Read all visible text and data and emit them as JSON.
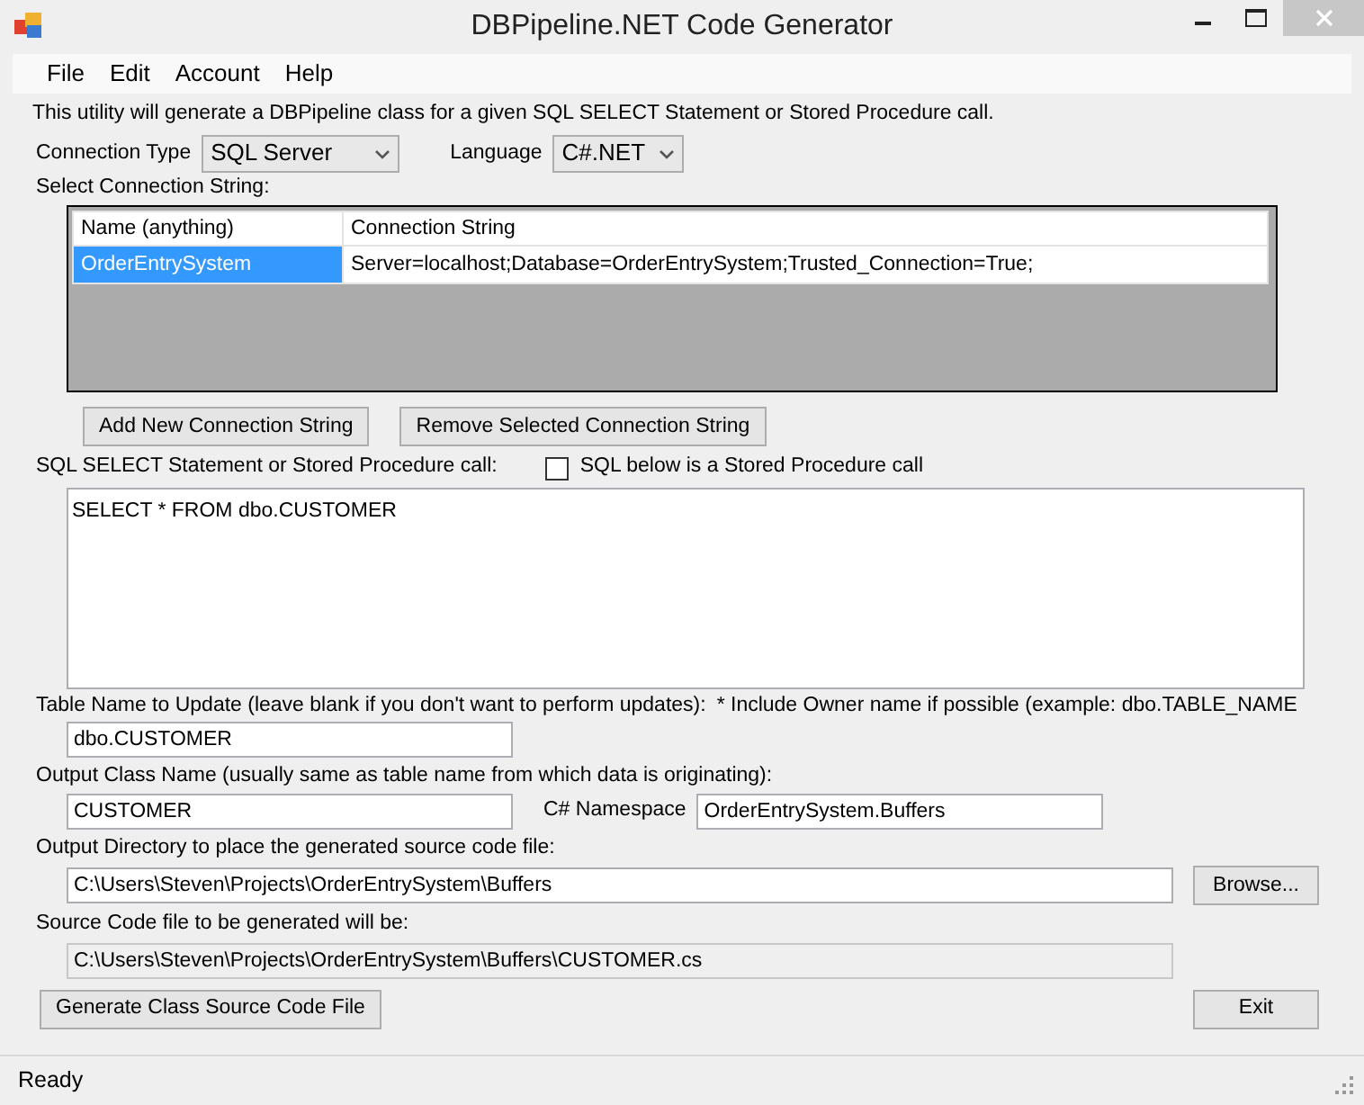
{
  "window": {
    "title": "DBPipeline.NET Code Generator"
  },
  "menu": [
    {
      "label": "File"
    },
    {
      "label": "Edit"
    },
    {
      "label": "Account"
    },
    {
      "label": "Help"
    }
  ],
  "intro": "This utility will generate a DBPipeline class for a given SQL SELECT Statement or Stored Procedure call.",
  "connection_type": {
    "label": "Connection Type",
    "value": "SQL Server"
  },
  "language": {
    "label": "Language",
    "value": "C#.NET"
  },
  "connections": {
    "label": "Select Connection String:",
    "columns": [
      "Name (anything)",
      "Connection String"
    ],
    "rows": [
      {
        "cells": [
          "OrderEntrySystem",
          "Server=localhost;Database=OrderEntrySystem;Trusted_Connection=True;"
        ],
        "selected": true
      }
    ]
  },
  "connection_buttons": [
    "Add New Connection String",
    "Remove Selected Connection String"
  ],
  "sql": {
    "label": "SQL SELECT Statement or Stored Procedure call:",
    "stored_procedure": {
      "label": "SQL below is a Stored Procedure call",
      "checked": false
    },
    "text": "SELECT * FROM dbo.CUSTOMER"
  },
  "table_name": {
    "label": "Table Name to Update (leave blank if you don't want to perform updates):",
    "note": "* Include Owner name if possible (example: dbo.TABLE_NAME",
    "value": "dbo.CUSTOMER"
  },
  "class_name": {
    "label": "Output Class Name (usually same as table name from which data is originating):",
    "value": "CUSTOMER"
  },
  "namespace": {
    "label": "C# Namespace",
    "value": "OrderEntrySystem.Buffers"
  },
  "output_dir": {
    "label": "Output Directory to place the generated source code file:",
    "value": "C:\\Users\\Steven\\Projects\\OrderEntrySystem\\Buffers",
    "button": "Browse..."
  },
  "source_file": {
    "label": "Source Code file to be generated will be:",
    "value": "C:\\Users\\Steven\\Projects\\OrderEntrySystem\\Buffers\\CUSTOMER.cs",
    "read_only": true
  },
  "buttons": [
    "Generate Class Source Code File",
    "Exit"
  ],
  "status_bar": "Ready"
}
